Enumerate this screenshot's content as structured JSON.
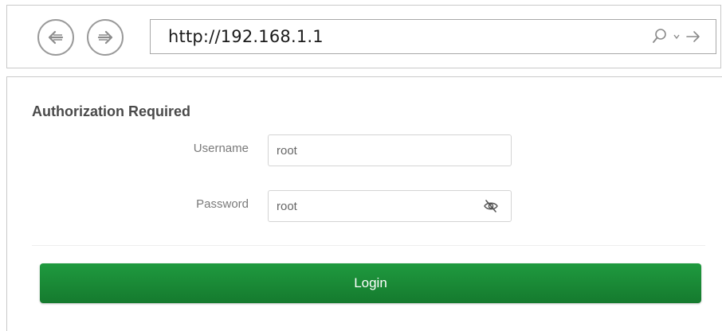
{
  "browser": {
    "url": "http://192.168.1.1",
    "back_icon": "back-arrow-icon",
    "forward_icon": "forward-arrow-icon",
    "search_icon": "search-icon",
    "dropdown_icon": "chevron-down-icon",
    "go_icon": "go-arrow-icon"
  },
  "auth": {
    "title": "Authorization Required",
    "username_label": "Username",
    "username_value": "root",
    "password_label": "Password",
    "password_value": "root",
    "reveal_icon": "eye-slash-icon",
    "login_label": "Login"
  },
  "colors": {
    "login_button": "#1a8a38",
    "title_text": "#4a4a4a",
    "label_text": "#7a7a7a"
  }
}
